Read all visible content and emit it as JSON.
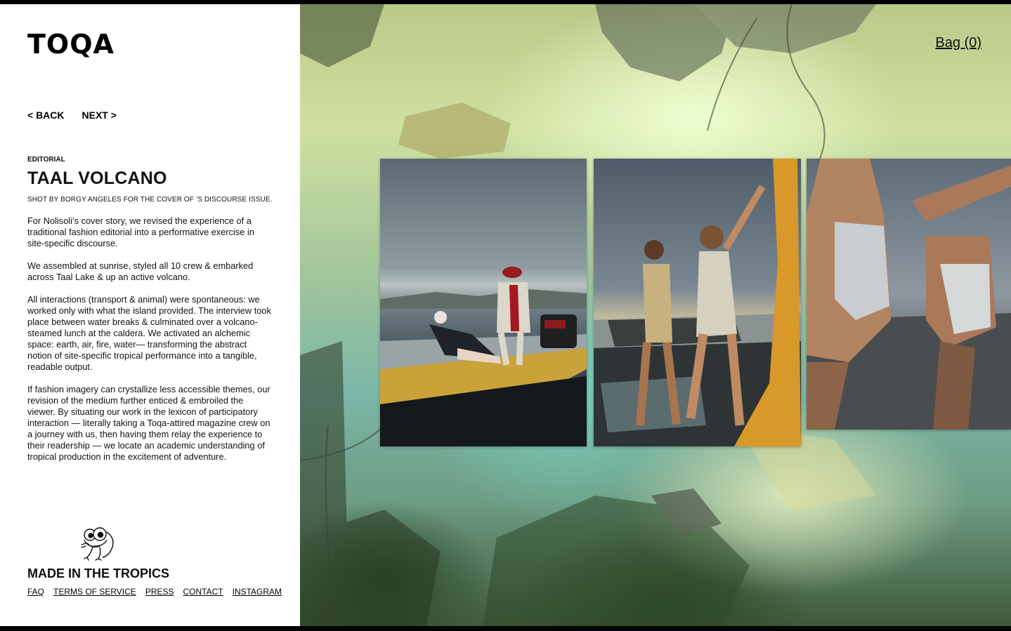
{
  "brand": {
    "logo": "TOQA"
  },
  "nav": {
    "back": "< BACK",
    "next": "NEXT >"
  },
  "article": {
    "tag": "EDITORIAL",
    "title": "TAAL VOLCANO",
    "credit": "SHOT BY BORGY ANGELES FOR THE COVER OF ’S DISCOURSE ISSUE.",
    "paragraphs": [
      "For Nolisoli’s cover story, we revised the experience of a traditional fashion editorial into a performative exercise in site-specific discourse.",
      "We assembled at sunrise, styled all 10 crew & embarked across Taal Lake & up an active volcano.",
      "All interactions (transport & animal) were spontaneous: we worked only with what the island provided. The interview took place between water breaks & culminated over a volcano-steamed lunch at the caldera. We activated an alchemic space: earth, air, fire, water— transforming the abstract notion of site-specific tropical performance into a tangible, readable output.",
      "If fashion imagery can crystallize less accessible themes, our revision of the medium further enticed & embroiled the viewer. By situating our work in the lexicon of participatory interaction — literally taking a Toqa-attired magazine crew on a journey with us, then having them relay the experience to their readership — we locate an academic understanding of tropical production in the excitement of adventure."
    ]
  },
  "footer": {
    "tagline": "MADE IN THE TROPICS",
    "links": [
      "FAQ",
      "TERMS OF SERVICE",
      "PRESS",
      "CONTACT",
      "INSTAGRAM"
    ]
  },
  "header": {
    "bag": "Bag (0)"
  }
}
